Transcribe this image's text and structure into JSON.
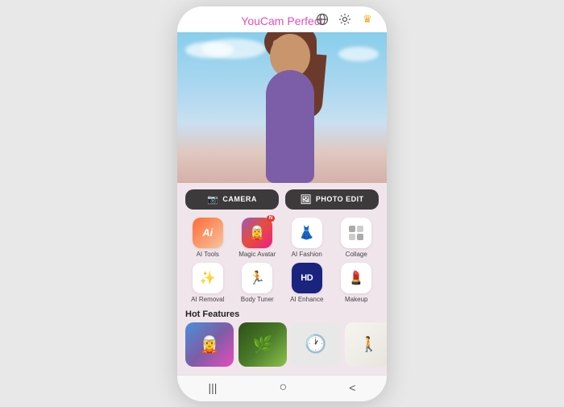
{
  "app": {
    "title_youcam": "YouCam",
    "title_perfect": "Perfect"
  },
  "header": {
    "icons": [
      "globe-icon",
      "settings-icon",
      "crown-icon"
    ]
  },
  "mode_buttons": [
    {
      "id": "camera-btn",
      "label": "CAMERA",
      "icon": "📷"
    },
    {
      "id": "photo-edit-btn",
      "label": "PHOTO EDIT",
      "icon": "🖼"
    }
  ],
  "tools": [
    {
      "id": "ai-tools",
      "label": "AI Tools",
      "icon": "ai",
      "badge": null
    },
    {
      "id": "magic-avatar",
      "label": "Magic Avatar",
      "icon": "magic",
      "badge": "N"
    },
    {
      "id": "ai-fashion",
      "label": "AI Fashion",
      "icon": "👗",
      "badge": null
    },
    {
      "id": "collage",
      "label": "Collage",
      "icon": "collage",
      "badge": null
    },
    {
      "id": "ai-removal",
      "label": "AI Removal",
      "icon": "✨",
      "badge": null
    },
    {
      "id": "body-tuner",
      "label": "Body Tuner",
      "icon": "🏃",
      "badge": null
    },
    {
      "id": "ai-enhance",
      "label": "AI Enhance",
      "icon": "HD",
      "badge": null
    },
    {
      "id": "makeup",
      "label": "Makeup",
      "icon": "💄",
      "badge": null
    }
  ],
  "hot_features": {
    "label": "Hot Features",
    "cards": [
      "card1",
      "card2",
      "card3",
      "card4",
      "card5"
    ]
  },
  "bottom_nav": {
    "icons": [
      "|||",
      "○",
      "<"
    ]
  }
}
